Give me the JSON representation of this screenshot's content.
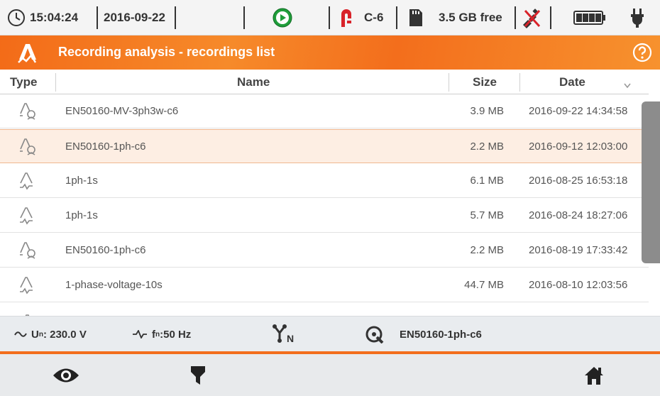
{
  "status": {
    "time": "15:04:24",
    "date": "2016-09-22",
    "clamp": "C-6",
    "storage": "3.5 GB free"
  },
  "header": {
    "title": "Recording analysis - recordings list"
  },
  "table": {
    "columns": {
      "type": "Type",
      "name": "Name",
      "size": "Size",
      "date": "Date"
    },
    "rows": [
      {
        "icon": "measurement-star-icon",
        "name": "EN50160-MV-3ph3w-c6",
        "size": "3.9 MB",
        "date": "2016-09-22 14:34:58"
      },
      {
        "icon": "measurement-star-icon",
        "name": "EN50160-1ph-c6",
        "size": "2.2 MB",
        "date": "2016-09-12 12:03:00",
        "selected": true
      },
      {
        "icon": "waveform-icon",
        "name": "1ph-1s",
        "size": "6.1 MB",
        "date": "2016-08-25 16:53:18"
      },
      {
        "icon": "waveform-icon",
        "name": "1ph-1s",
        "size": "5.7 MB",
        "date": "2016-08-24 18:27:06"
      },
      {
        "icon": "measurement-star-icon",
        "name": "EN50160-1ph-c6",
        "size": "2.2 MB",
        "date": "2016-08-19 17:33:42"
      },
      {
        "icon": "waveform-icon",
        "name": "1-phase-voltage-10s",
        "size": "44.7 MB",
        "date": "2016-08-10 12:03:56"
      }
    ]
  },
  "infobar": {
    "un_label": "U",
    "un_sub": "n",
    "un_value": ": 230.0 V",
    "fn_label": "f",
    "fn_sub": "n",
    "fn_value": ":50 Hz",
    "config": "EN50160-1ph-c6"
  },
  "colors": {
    "accent": "#f36e1c",
    "selected_row": "#fdeee3",
    "play_green": "#1f9d3a",
    "clamp_red": "#d8232a"
  }
}
